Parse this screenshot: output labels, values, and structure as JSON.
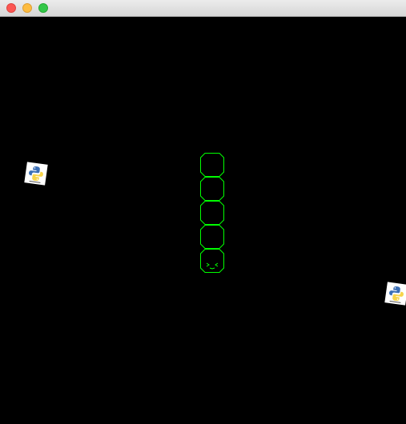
{
  "window": {
    "controls": [
      "close",
      "minimize",
      "maximize"
    ]
  },
  "game": {
    "background": "#000000",
    "snake_color": "#00ff00",
    "snake_length": 5,
    "direction": "down",
    "food_count": 2,
    "food_icon": "python-logo-icon"
  }
}
